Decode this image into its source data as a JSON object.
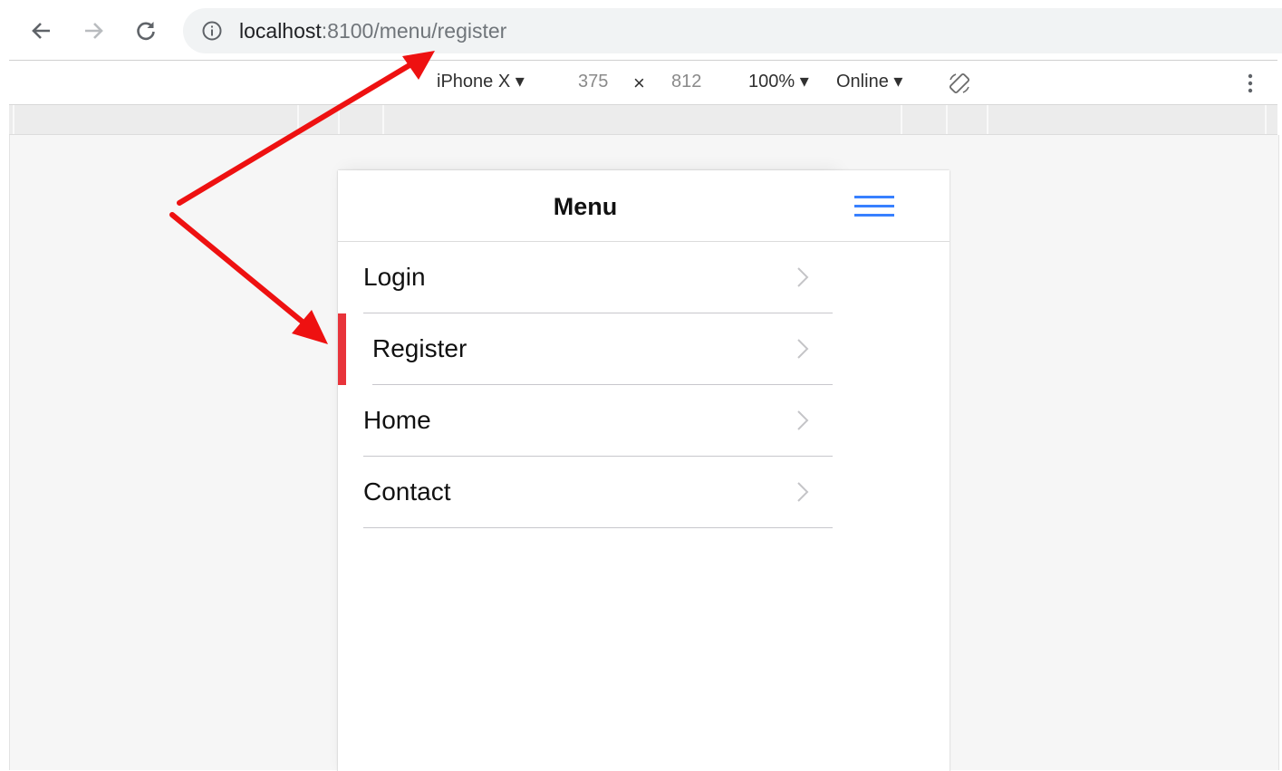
{
  "browser": {
    "back_icon": "arrow-left-icon",
    "forward_icon": "arrow-right-icon",
    "reload_icon": "reload-icon",
    "info_icon": "info-icon",
    "url_host": "localhost",
    "url_rest": ":8100/menu/register"
  },
  "device_toolbar": {
    "device": "iPhone X ▾",
    "width": "375",
    "times": "×",
    "height": "812",
    "zoom": "100% ▾",
    "network": "Online ▾",
    "rotate_icon": "rotate-icon",
    "more_icon": "more-vertical-icon"
  },
  "app": {
    "menu_title": "Menu",
    "menu_items": [
      {
        "label": "Login"
      },
      {
        "label": "Register"
      },
      {
        "label": "Home"
      },
      {
        "label": "Contact"
      }
    ],
    "active_index": 1,
    "hamburger_icon": "menu-icon"
  },
  "colors": {
    "active_indicator": "#e8333a",
    "hamburger": "#3880ff",
    "annotation_arrow": "#ee1111"
  }
}
